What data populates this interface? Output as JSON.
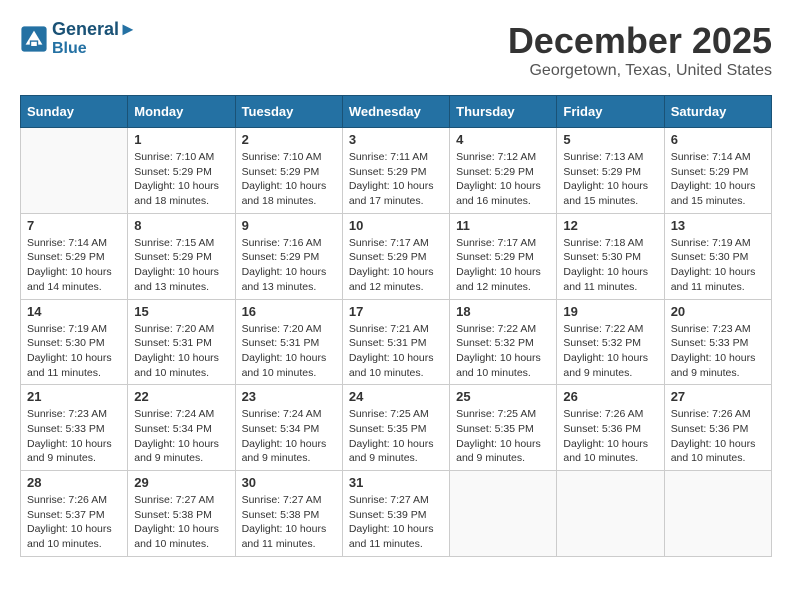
{
  "header": {
    "logo_line1": "General",
    "logo_line2": "Blue",
    "month_title": "December 2025",
    "location": "Georgetown, Texas, United States"
  },
  "days_of_week": [
    "Sunday",
    "Monday",
    "Tuesday",
    "Wednesday",
    "Thursday",
    "Friday",
    "Saturday"
  ],
  "weeks": [
    [
      {
        "day": "",
        "info": ""
      },
      {
        "day": "1",
        "info": "Sunrise: 7:10 AM\nSunset: 5:29 PM\nDaylight: 10 hours\nand 18 minutes."
      },
      {
        "day": "2",
        "info": "Sunrise: 7:10 AM\nSunset: 5:29 PM\nDaylight: 10 hours\nand 18 minutes."
      },
      {
        "day": "3",
        "info": "Sunrise: 7:11 AM\nSunset: 5:29 PM\nDaylight: 10 hours\nand 17 minutes."
      },
      {
        "day": "4",
        "info": "Sunrise: 7:12 AM\nSunset: 5:29 PM\nDaylight: 10 hours\nand 16 minutes."
      },
      {
        "day": "5",
        "info": "Sunrise: 7:13 AM\nSunset: 5:29 PM\nDaylight: 10 hours\nand 15 minutes."
      },
      {
        "day": "6",
        "info": "Sunrise: 7:14 AM\nSunset: 5:29 PM\nDaylight: 10 hours\nand 15 minutes."
      }
    ],
    [
      {
        "day": "7",
        "info": "Sunrise: 7:14 AM\nSunset: 5:29 PM\nDaylight: 10 hours\nand 14 minutes."
      },
      {
        "day": "8",
        "info": "Sunrise: 7:15 AM\nSunset: 5:29 PM\nDaylight: 10 hours\nand 13 minutes."
      },
      {
        "day": "9",
        "info": "Sunrise: 7:16 AM\nSunset: 5:29 PM\nDaylight: 10 hours\nand 13 minutes."
      },
      {
        "day": "10",
        "info": "Sunrise: 7:17 AM\nSunset: 5:29 PM\nDaylight: 10 hours\nand 12 minutes."
      },
      {
        "day": "11",
        "info": "Sunrise: 7:17 AM\nSunset: 5:29 PM\nDaylight: 10 hours\nand 12 minutes."
      },
      {
        "day": "12",
        "info": "Sunrise: 7:18 AM\nSunset: 5:30 PM\nDaylight: 10 hours\nand 11 minutes."
      },
      {
        "day": "13",
        "info": "Sunrise: 7:19 AM\nSunset: 5:30 PM\nDaylight: 10 hours\nand 11 minutes."
      }
    ],
    [
      {
        "day": "14",
        "info": "Sunrise: 7:19 AM\nSunset: 5:30 PM\nDaylight: 10 hours\nand 11 minutes."
      },
      {
        "day": "15",
        "info": "Sunrise: 7:20 AM\nSunset: 5:31 PM\nDaylight: 10 hours\nand 10 minutes."
      },
      {
        "day": "16",
        "info": "Sunrise: 7:20 AM\nSunset: 5:31 PM\nDaylight: 10 hours\nand 10 minutes."
      },
      {
        "day": "17",
        "info": "Sunrise: 7:21 AM\nSunset: 5:31 PM\nDaylight: 10 hours\nand 10 minutes."
      },
      {
        "day": "18",
        "info": "Sunrise: 7:22 AM\nSunset: 5:32 PM\nDaylight: 10 hours\nand 10 minutes."
      },
      {
        "day": "19",
        "info": "Sunrise: 7:22 AM\nSunset: 5:32 PM\nDaylight: 10 hours\nand 9 minutes."
      },
      {
        "day": "20",
        "info": "Sunrise: 7:23 AM\nSunset: 5:33 PM\nDaylight: 10 hours\nand 9 minutes."
      }
    ],
    [
      {
        "day": "21",
        "info": "Sunrise: 7:23 AM\nSunset: 5:33 PM\nDaylight: 10 hours\nand 9 minutes."
      },
      {
        "day": "22",
        "info": "Sunrise: 7:24 AM\nSunset: 5:34 PM\nDaylight: 10 hours\nand 9 minutes."
      },
      {
        "day": "23",
        "info": "Sunrise: 7:24 AM\nSunset: 5:34 PM\nDaylight: 10 hours\nand 9 minutes."
      },
      {
        "day": "24",
        "info": "Sunrise: 7:25 AM\nSunset: 5:35 PM\nDaylight: 10 hours\nand 9 minutes."
      },
      {
        "day": "25",
        "info": "Sunrise: 7:25 AM\nSunset: 5:35 PM\nDaylight: 10 hours\nand 9 minutes."
      },
      {
        "day": "26",
        "info": "Sunrise: 7:26 AM\nSunset: 5:36 PM\nDaylight: 10 hours\nand 10 minutes."
      },
      {
        "day": "27",
        "info": "Sunrise: 7:26 AM\nSunset: 5:36 PM\nDaylight: 10 hours\nand 10 minutes."
      }
    ],
    [
      {
        "day": "28",
        "info": "Sunrise: 7:26 AM\nSunset: 5:37 PM\nDaylight: 10 hours\nand 10 minutes."
      },
      {
        "day": "29",
        "info": "Sunrise: 7:27 AM\nSunset: 5:38 PM\nDaylight: 10 hours\nand 10 minutes."
      },
      {
        "day": "30",
        "info": "Sunrise: 7:27 AM\nSunset: 5:38 PM\nDaylight: 10 hours\nand 11 minutes."
      },
      {
        "day": "31",
        "info": "Sunrise: 7:27 AM\nSunset: 5:39 PM\nDaylight: 10 hours\nand 11 minutes."
      },
      {
        "day": "",
        "info": ""
      },
      {
        "day": "",
        "info": ""
      },
      {
        "day": "",
        "info": ""
      }
    ]
  ]
}
